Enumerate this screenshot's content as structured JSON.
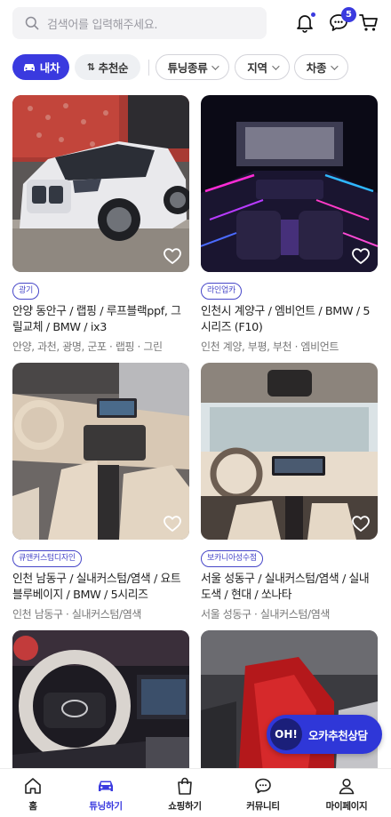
{
  "search": {
    "placeholder": "검색어를 입력해주세요."
  },
  "header": {
    "chat_badge": "5"
  },
  "filters": {
    "my_car": "내차",
    "sort": "추천순",
    "tuning_type": "튜닝종류",
    "region": "지역",
    "car_type": "차종"
  },
  "cards": [
    {
      "badge": "광기",
      "title": "안양 동안구 / 랩핑 / 루프블랙ppf, 그릴교체 / BMW / ix3",
      "subtitle": "안양, 과천, 광명, 군포 · 랩핑 · 그린"
    },
    {
      "badge": "라인업카",
      "title": "인천시 계양구 / 엠비언트 / BMW / 5시리즈 (F10)",
      "subtitle": "인천 계양, 부평, 부천 · 엠비언트"
    },
    {
      "badge": "큐앤커스텀디자인",
      "title": "인천 남동구 / 실내커스텀/염색 / 요트블루베이지 / BMW / 5시리즈",
      "subtitle": "인천 남동구 · 실내커스텀/염색"
    },
    {
      "badge": "보카니아성수점",
      "title": "서울 성동구 / 실내커스텀/염색 / 실내도색 / 현대 / 쏘나타",
      "subtitle": "서울 성동구 · 실내커스텀/염색"
    },
    {
      "badge": "",
      "title": "",
      "subtitle": ""
    },
    {
      "badge": "",
      "title": "",
      "subtitle": ""
    }
  ],
  "consult": {
    "logo": "OH!",
    "label": "오카추천상담"
  },
  "bottom_nav": [
    {
      "label": "홈"
    },
    {
      "label": "튜닝하기"
    },
    {
      "label": "쇼핑하기"
    },
    {
      "label": "커뮤니티"
    },
    {
      "label": "마이페이지"
    }
  ],
  "colors": {
    "accent": "#3a3adf",
    "badge_border": "#4646c8"
  }
}
